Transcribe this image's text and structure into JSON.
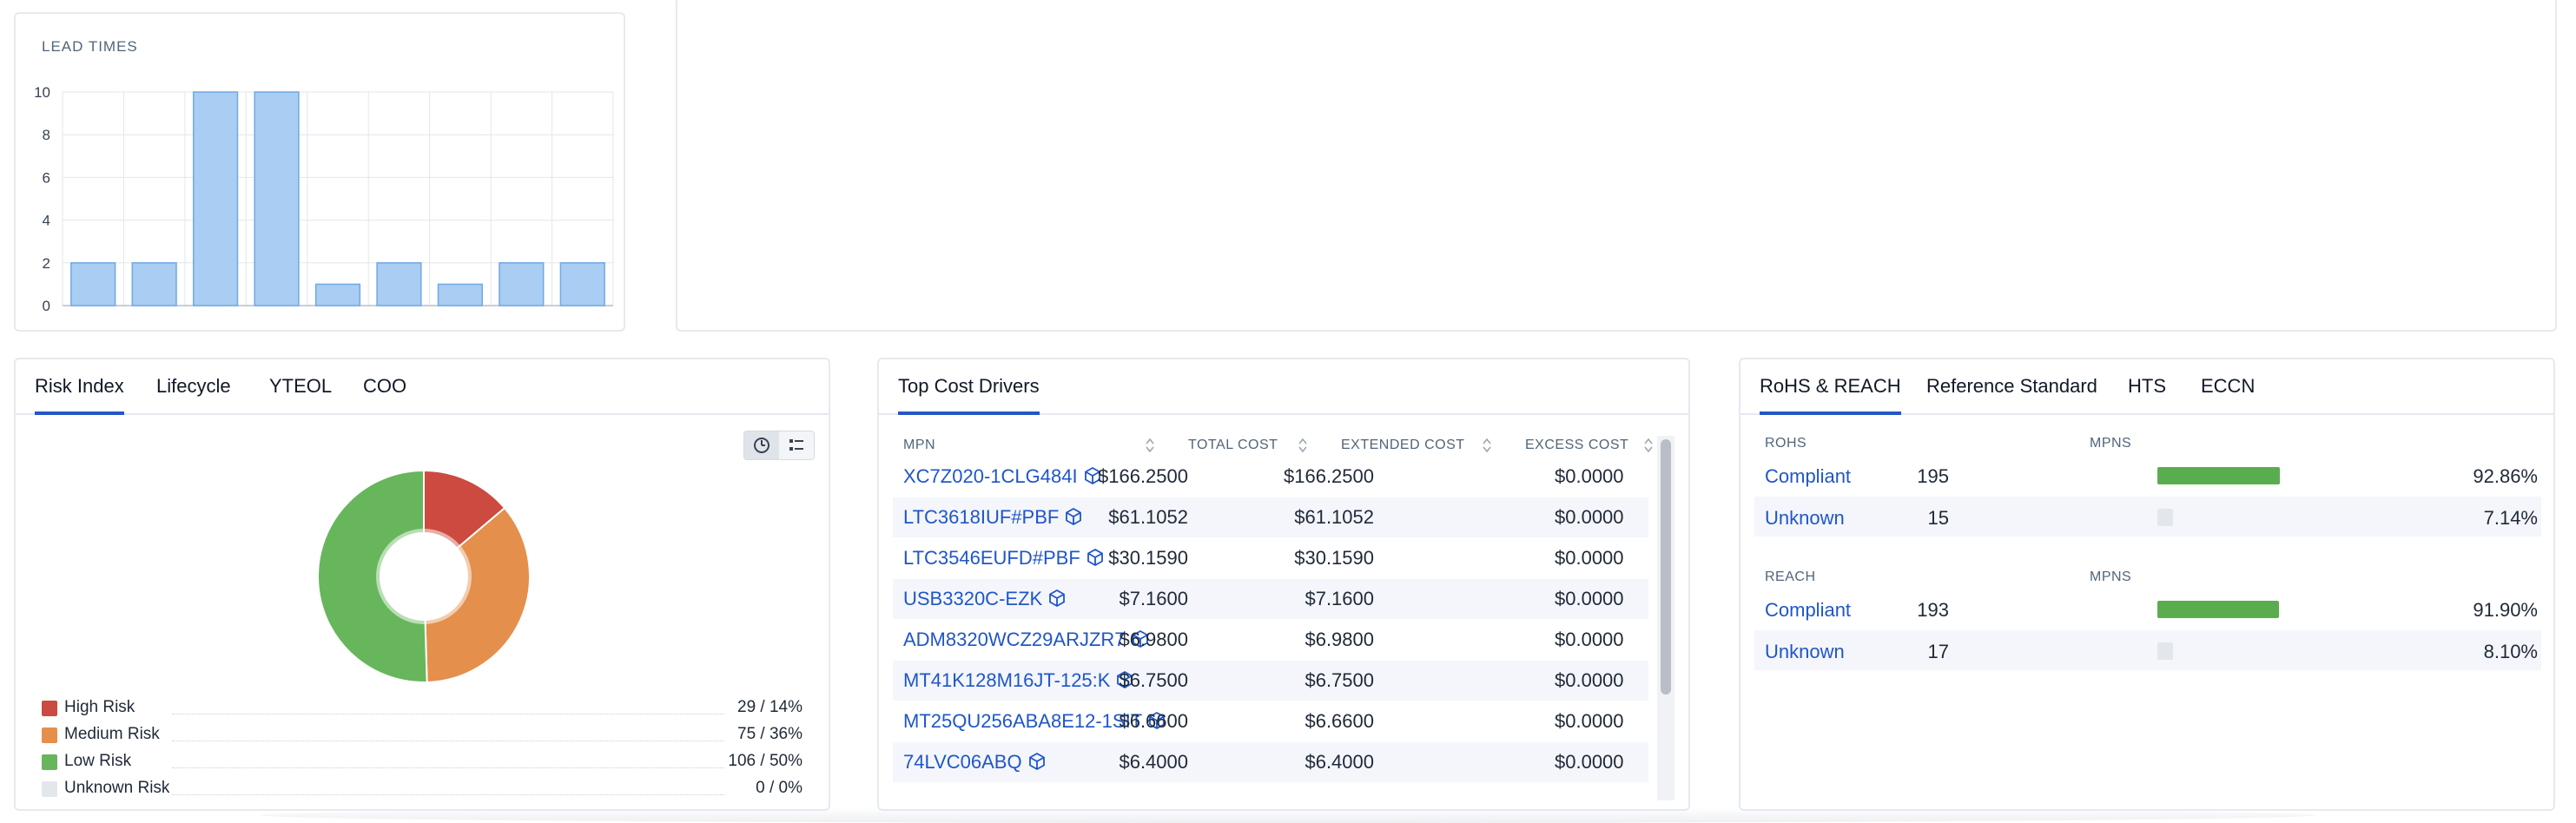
{
  "lead_times": {
    "title": "LEAD TIMES",
    "chart_data": {
      "type": "bar",
      "title": "LEAD TIMES",
      "categories": [
        "",
        "",
        "",
        "",
        "",
        "",
        "",
        "",
        ""
      ],
      "values": [
        2,
        2,
        10,
        10,
        1,
        2,
        1,
        2,
        2
      ],
      "ylim": [
        0,
        10
      ],
      "yticks": [
        "0",
        "2",
        "4",
        "6",
        "8",
        "10"
      ],
      "grid": true,
      "bar_color": "#a9cdf3",
      "bar_edge_color": "#6fa8e6"
    }
  },
  "risk_panel": {
    "tabs": [
      "Risk Index",
      "Lifecycle",
      "YTEOL",
      "COO"
    ],
    "active_tab": 0,
    "view_toggle": {
      "pie_icon": "pie-chart-icon",
      "list_icon": "list-icon"
    },
    "chart_data": {
      "type": "pie",
      "donut": true,
      "slices": [
        {
          "label": "High Risk",
          "value": 29,
          "percent": 14,
          "color": "#cc4a3f"
        },
        {
          "label": "Medium Risk",
          "value": 75,
          "percent": 36,
          "color": "#e48f4c"
        },
        {
          "label": "Low Risk",
          "value": 106,
          "percent": 50,
          "color": "#67b65c"
        },
        {
          "label": "Unknown Risk",
          "value": 0,
          "percent": 0,
          "color": "#e3e7ec"
        }
      ]
    },
    "legend": [
      {
        "label": "High Risk",
        "value": "29 / 14%",
        "color": "#cc4a3f"
      },
      {
        "label": "Medium Risk",
        "value": "75 / 36%",
        "color": "#e48f4c"
      },
      {
        "label": "Low Risk",
        "value": "106 / 50%",
        "color": "#67b65c"
      },
      {
        "label": "Unknown Risk",
        "value": "0 / 0%",
        "color": "#e3e7ec"
      }
    ]
  },
  "cost_panel": {
    "tab": "Top Cost Drivers",
    "headers": [
      "MPN",
      "TOTAL COST",
      "EXTENDED COST",
      "EXCESS COST"
    ],
    "rows": [
      {
        "mpn": "XC7Z020-1CLG484I",
        "total": "$166.2500",
        "extended": "$166.2500",
        "excess": "$0.0000"
      },
      {
        "mpn": "LTC3618IUF#PBF",
        "total": "$61.1052",
        "extended": "$61.1052",
        "excess": "$0.0000"
      },
      {
        "mpn": "LTC3546EUFD#PBF",
        "total": "$30.1590",
        "extended": "$30.1590",
        "excess": "$0.0000"
      },
      {
        "mpn": "USB3320C-EZK",
        "total": "$7.1600",
        "extended": "$7.1600",
        "excess": "$0.0000"
      },
      {
        "mpn": "ADM8320WCZ29ARJZR7",
        "total": "$6.9800",
        "extended": "$6.9800",
        "excess": "$0.0000"
      },
      {
        "mpn": "MT41K128M16JT-125:K",
        "total": "$6.7500",
        "extended": "$6.7500",
        "excess": "$0.0000"
      },
      {
        "mpn": "MT25QU256ABA8E12-1SIT",
        "total": "$6.6600",
        "extended": "$6.6600",
        "excess": "$0.0000"
      },
      {
        "mpn": "74LVC06ABQ",
        "total": "$6.4000",
        "extended": "$6.4000",
        "excess": "$0.0000"
      }
    ]
  },
  "compliance_panel": {
    "tabs": [
      "RoHS & REACH",
      "Reference Standard",
      "HTS",
      "ECCN"
    ],
    "active_tab": 0,
    "rohs": {
      "header": "ROHS",
      "mpns_header": "MPNS",
      "rows": [
        {
          "label": "Compliant",
          "count": "195",
          "percent": "92.86%",
          "fill": 92.86,
          "color": "#5aad4e"
        },
        {
          "label": "Unknown",
          "count": "15",
          "percent": "7.14%",
          "fill": 7.14,
          "color": "#e3e7ec"
        }
      ]
    },
    "reach": {
      "header": "REACH",
      "mpns_header": "MPNS",
      "rows": [
        {
          "label": "Compliant",
          "count": "193",
          "percent": "91.90%",
          "fill": 91.9,
          "color": "#5aad4e"
        },
        {
          "label": "Unknown",
          "count": "17",
          "percent": "8.10%",
          "fill": 8.1,
          "color": "#e3e7ec"
        }
      ]
    }
  }
}
